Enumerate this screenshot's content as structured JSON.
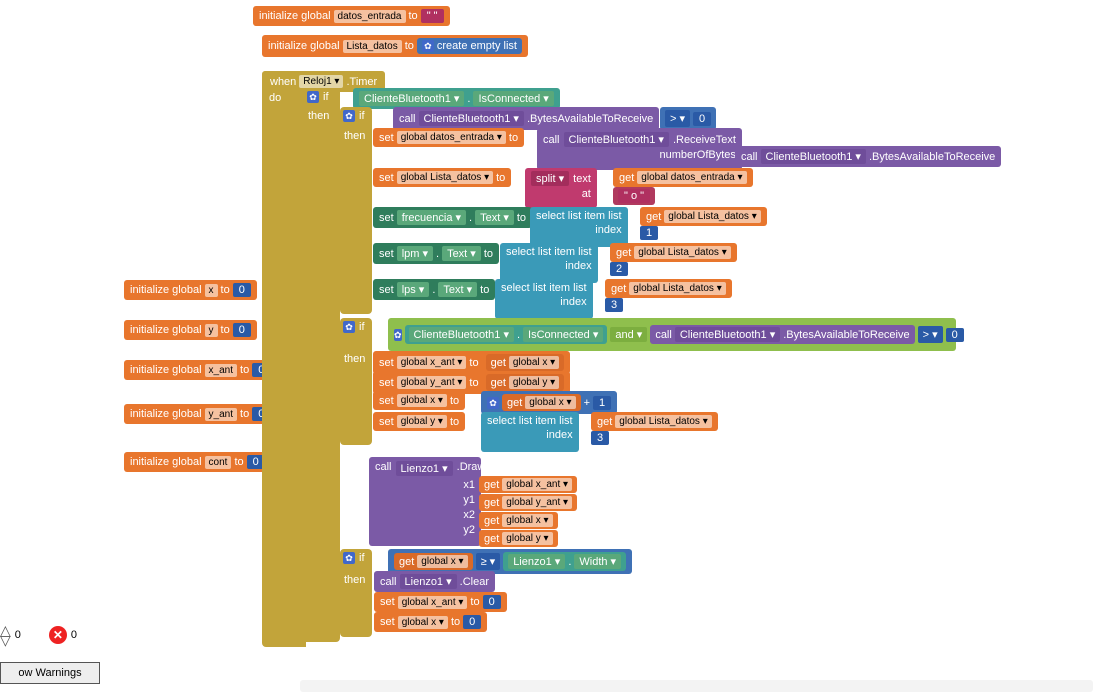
{
  "init": {
    "prefix": "initialize global",
    "to": "to",
    "datos_entrada": "datos_entrada",
    "lista_datos": "Lista_datos",
    "create_empty": "create empty list",
    "x": "x",
    "y": "y",
    "x_ant": "x_ant",
    "y_ant": "y_ant",
    "cont": "cont",
    "zero": "0",
    "quote": "\" \""
  },
  "when": {
    "when": "when",
    "reloj": "Reloj1 ▾",
    "timer": ".Timer",
    "do": "do"
  },
  "kw": {
    "if": "if",
    "then": "then",
    "set": "set",
    "get": "get",
    "call": "call",
    "and": "and ▾"
  },
  "bt": {
    "client": "ClienteBluetooth1 ▾",
    "isconn": "IsConnected ▾",
    "bytesavail": ".BytesAvailableToReceive",
    "recv": ".ReceiveText",
    "numbytes": "numberOfBytes"
  },
  "cmp": {
    "gt": "> ▾",
    "ge": "≥ ▾",
    "zero": "0"
  },
  "vars": {
    "datos_entrada": "global datos_entrada ▾",
    "lista_datos": "global Lista_datos ▾",
    "x": "global x ▾",
    "y": "global y ▾",
    "x_ant": "global x_ant ▾",
    "y_ant": "global y_ant ▾"
  },
  "split": {
    "split": "split ▾",
    "text": "text",
    "at": "at",
    "sep": "\" o \""
  },
  "sel": {
    "selitem": "select list item  list",
    "index": "index",
    "i1": "1",
    "i2": "2",
    "i3": "3"
  },
  "txt": {
    "text": "Text ▾",
    "frecuencia": "frecuencia ▾",
    "lpm": "lpm ▾",
    "lps": "lps ▾",
    "dot": "."
  },
  "math": {
    "plus": "+",
    "one": "1"
  },
  "draw": {
    "lienzo": "Lienzo1 ▾",
    "drawline": ".DrawLine",
    "clear": ".Clear",
    "x1": "x1",
    "y1": "y1",
    "x2": "x2",
    "y2": "y2",
    "width": "Width ▾"
  },
  "bottom": {
    "zero": "0",
    "warn": "ow Warnings"
  }
}
